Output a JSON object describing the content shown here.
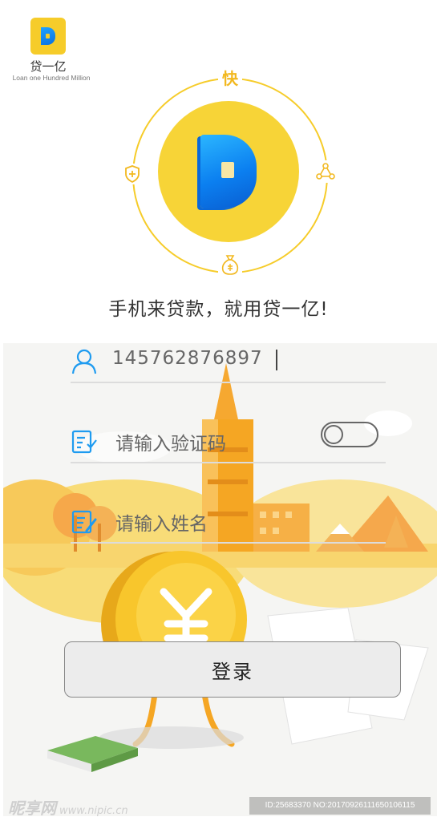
{
  "brand": {
    "name": "贷一亿",
    "tagline": "Loan one Hundred Million",
    "slogan": "手机来贷款，就用贷一亿!"
  },
  "orbit": {
    "top_char": "快",
    "left_icon": "shield-plus-icon",
    "right_icon": "network-nodes-icon",
    "bottom_icon": "money-bag-icon"
  },
  "form": {
    "phone": {
      "value": "145762876897",
      "icon": "user-icon"
    },
    "code": {
      "placeholder": "请输入验证码",
      "icon": "verify-code-icon",
      "toggle": "off"
    },
    "name": {
      "placeholder": "请输入姓名",
      "icon": "edit-document-icon"
    }
  },
  "login": {
    "label": "登录"
  },
  "watermark": {
    "site": "昵享网",
    "url": "www.nipic.cn",
    "id_text": "ID:25683370 NO:20170926111650106115"
  },
  "colors": {
    "accent": "#f6cc2a",
    "logo_blue": "#0b7ff0",
    "illustration_orange": "#f5a623"
  }
}
